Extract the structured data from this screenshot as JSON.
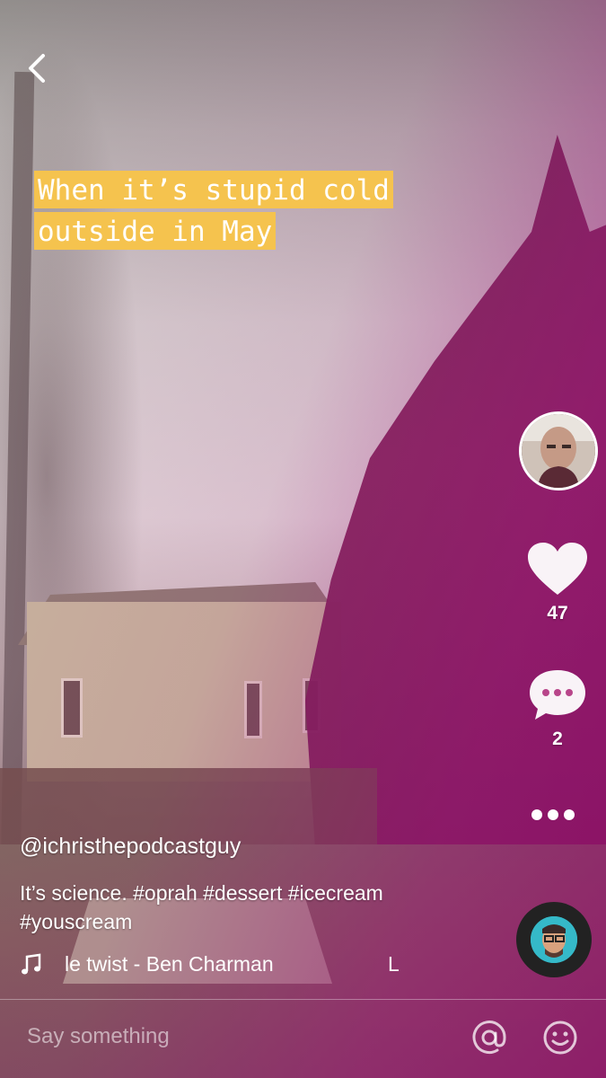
{
  "caption": {
    "line1": "When it’s stupid cold",
    "line2": "outside in May"
  },
  "author": {
    "username": "@ichristhepodcastguy"
  },
  "post": {
    "description": "It’s science. #oprah #dessert #icecream #youscream"
  },
  "music": {
    "icon": "music-note-icon",
    "track_text": "le twist - Ben Charman",
    "track_overflow": "L"
  },
  "actions": {
    "likes": "47",
    "comments": "2"
  },
  "comment_bar": {
    "placeholder": "Say something"
  },
  "colors": {
    "caption_bg": "#f5c34e",
    "text": "#ffffff"
  }
}
